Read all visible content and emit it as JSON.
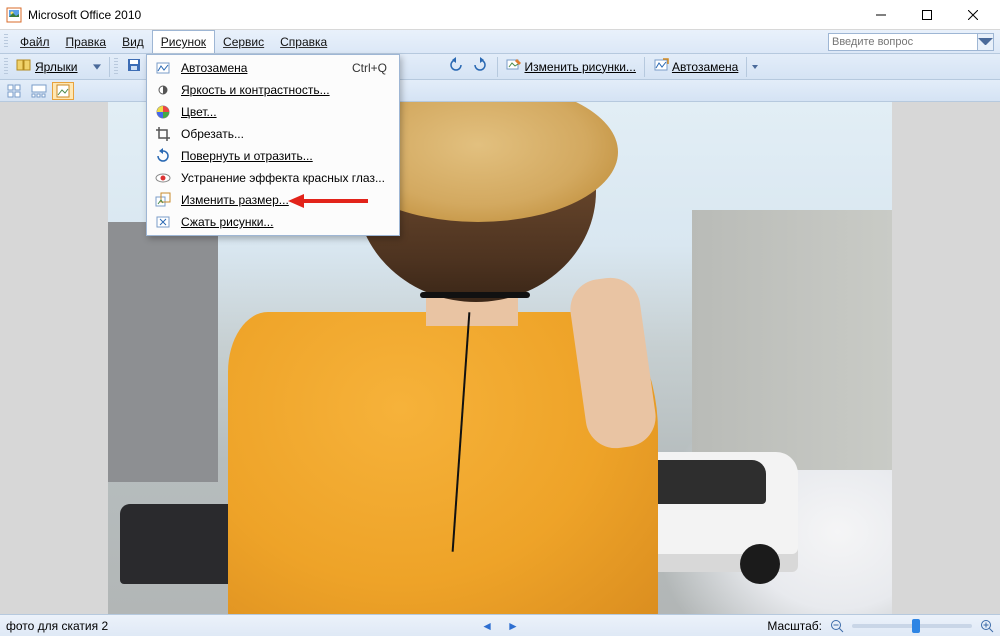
{
  "app": {
    "title": "Microsoft Office 2010"
  },
  "menubar": {
    "file": "Файл",
    "edit": "Правка",
    "view": "Вид",
    "picture": "Рисунок",
    "tools": "Сервис",
    "help": "Справка",
    "ask_placeholder": "Введите вопрос"
  },
  "toolbar": {
    "shortcuts": "Ярлыки",
    "edit_pictures": "Изменить рисунки...",
    "autocorrect": "Автозамена"
  },
  "menu_picture": {
    "autocorrect": {
      "label": "Автозамена",
      "accel": "Ctrl+Q"
    },
    "brightness": {
      "label": "Яркость и контрастность..."
    },
    "color": {
      "label": "Цвет..."
    },
    "crop": {
      "label": "Обрезать..."
    },
    "rotate": {
      "label": "Повернуть и отразить..."
    },
    "redeye": {
      "label": "Устранение эффекта красных глаз..."
    },
    "resize": {
      "label": "Изменить размер..."
    },
    "compress": {
      "label": "Сжать рисунки..."
    }
  },
  "statusbar": {
    "filename": "фото для скатия 2",
    "zoom_label": "Масштаб:"
  }
}
